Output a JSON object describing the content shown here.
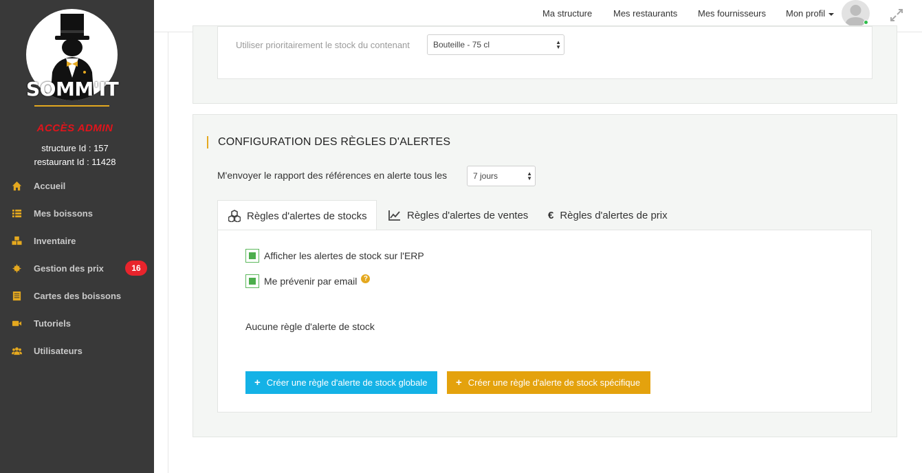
{
  "sidebar": {
    "logo_text": "SOMM'IT",
    "admin_label": "ACCÈS ADMIN",
    "structure_id": "structure Id : 157",
    "restaurant_id": "restaurant Id : 11428",
    "items": [
      {
        "label": "Accueil",
        "icon": "home-icon"
      },
      {
        "label": "Mes boissons",
        "icon": "list-icon"
      },
      {
        "label": "Inventaire",
        "icon": "cubes-icon"
      },
      {
        "label": "Gestion des prix",
        "icon": "coins-icon",
        "badge": "16"
      },
      {
        "label": "Cartes des boissons",
        "icon": "menu-card-icon"
      },
      {
        "label": "Tutoriels",
        "icon": "video-camera-icon"
      },
      {
        "label": "Utilisateurs",
        "icon": "users-icon"
      }
    ]
  },
  "topbar": {
    "links": [
      "Ma structure",
      "Mes restaurants",
      "Mes fournisseurs"
    ],
    "profile_label": "Mon profil"
  },
  "container_section": {
    "label": "Utiliser prioritairement le stock du contenant",
    "select_value": "Bouteille - 75 cl"
  },
  "alerts_section": {
    "title": "CONFIGURATION DES RÈGLES D'ALERTES",
    "report_label": "M'envoyer le rapport des références en alerte tous les",
    "report_select_value": "7 jours",
    "tabs": [
      {
        "label": "Règles d'alertes de stocks",
        "icon": "cubes-icon"
      },
      {
        "label": "Règles d'alertes de ventes",
        "icon": "line-chart-icon"
      },
      {
        "label": "Règles d'alertes de prix",
        "icon": "euro-icon"
      }
    ],
    "checkboxes": [
      {
        "label": "Afficher les alertes de stock sur l'ERP",
        "checked": true
      },
      {
        "label": "Me prévenir par email",
        "checked": true
      }
    ],
    "empty_message": "Aucune règle d'alerte de stock",
    "buttons": {
      "global": "Créer une règle d'alerte de stock globale",
      "specific": "Créer une règle d'alerte de stock spécifique"
    }
  },
  "colors": {
    "sidebar_bg": "#393939",
    "accent": "#e4a81f",
    "admin_red": "#e1141b",
    "badge_red": "#e8242c",
    "button_blue": "#14b2e6",
    "button_orange": "#e4a20d",
    "checkbox_green": "#4cae4c"
  }
}
